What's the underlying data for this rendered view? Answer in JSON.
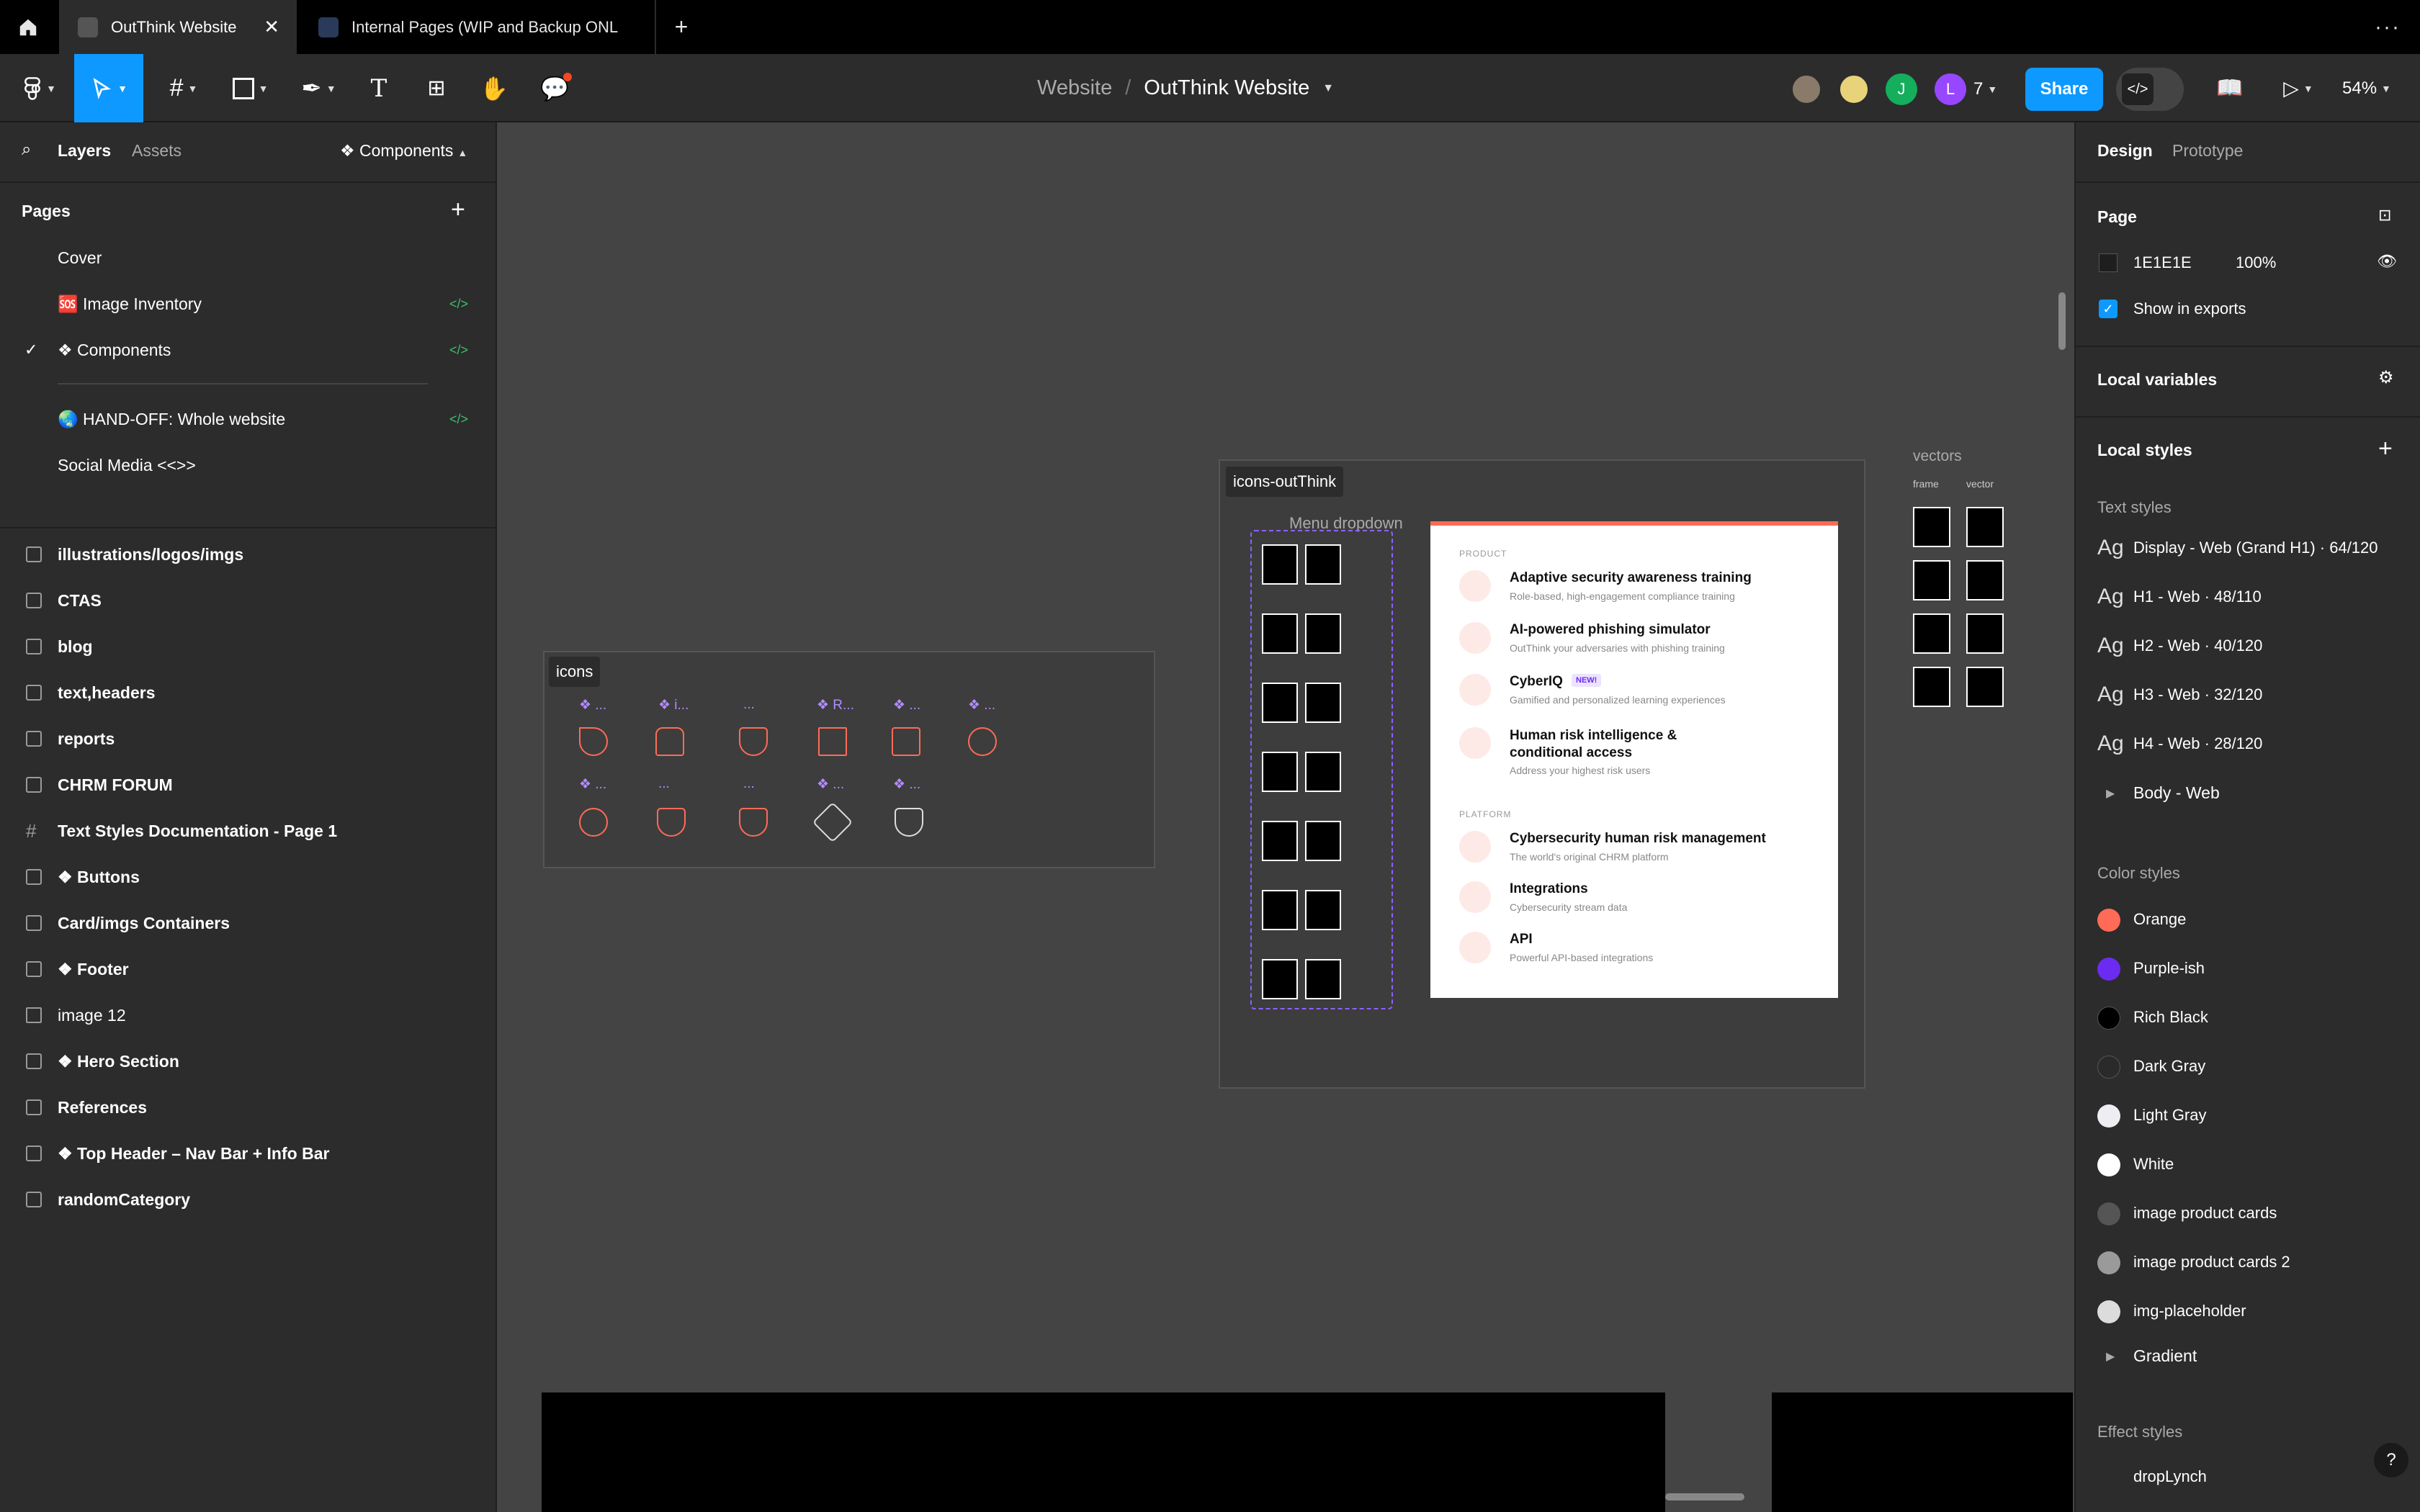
{
  "tabs": {
    "home_label": "",
    "tab1": "OutThink Website",
    "tab2": "Internal Pages (WIP and Backup ONL"
  },
  "toolbar": {
    "breadcrumb_project": "Website",
    "breadcrumb_sep": "/",
    "file_name": "OutThink Website",
    "collab_count": "7",
    "collab_j": "J",
    "collab_l": "L",
    "share": "Share",
    "zoom": "54%"
  },
  "left": {
    "tab_layers": "Layers",
    "tab_assets": "Assets",
    "components_switch": "❖ Components",
    "pages_title": "Pages",
    "pages": [
      "Cover",
      "🆘 Image Inventory",
      "❖ Components",
      "🌏 HAND-OFF: Whole website",
      "Social Media <<>>"
    ],
    "layers": [
      "illustrations/logos/imgs",
      "CTAS",
      "blog",
      "text,headers",
      "reports",
      "CHRM FORUM",
      "Text Styles Documentation - Page 1",
      "❖ Buttons",
      "Card/imgs Containers",
      "❖ Footer",
      "image 12",
      "❖ Hero Section",
      "References",
      "❖ Top Header – Nav Bar + Info Bar",
      "randomCategory"
    ]
  },
  "right": {
    "tab_design": "Design",
    "tab_prototype": "Prototype",
    "page_title": "Page",
    "page_color": "1E1E1E",
    "page_opacity": "100%",
    "show_exports": "Show in exports",
    "local_vars": "Local variables",
    "local_styles": "Local styles",
    "text_styles": "Text styles",
    "text_style_items": [
      "Display - Web (Grand H1) · 64/120",
      "H1 - Web · 48/110",
      "H2 - Web · 40/120",
      "H3 - Web · 32/120",
      "H4 - Web · 28/120"
    ],
    "body_web": "Body - Web",
    "color_styles": "Color styles",
    "colors": [
      {
        "name": "Orange",
        "hex": "#ff6b57"
      },
      {
        "name": "Purple-ish",
        "hex": "#6c2bf0"
      },
      {
        "name": "Rich Black",
        "hex": "#000000"
      },
      {
        "name": "Dark Gray",
        "hex": "#2a2a2a"
      },
      {
        "name": "Light Gray",
        "hex": "#eeeef2"
      },
      {
        "name": "White",
        "hex": "#ffffff"
      },
      {
        "name": "image product cards",
        "hex": "#555555"
      },
      {
        "name": "image product cards 2",
        "hex": "#9a9a9a"
      },
      {
        "name": "img-placeholder",
        "hex": "#dcdcdc"
      }
    ],
    "gradient": "Gradient",
    "effect_styles": "Effect styles",
    "effect_item": "dropLynch",
    "help": "?"
  },
  "canvas": {
    "icons_label": "icons",
    "icons_outthink_label": "icons-outThink",
    "menu_dropdown_label": "Menu dropdown",
    "vectors_label": "vectors",
    "vectors_frame": "frame",
    "vectors_vector": "vector",
    "icon_labels_row1": [
      "❖ ...",
      "❖ i...",
      "...",
      "❖ R...",
      "❖ ...",
      "❖ ..."
    ],
    "icon_labels_row2": [
      "❖ ...",
      "...",
      "...",
      "❖ ...",
      "❖ ..."
    ],
    "menu": {
      "product_heading": "PRODUCT",
      "platform_heading": "PLATFORM",
      "new_badge": "NEW!",
      "items": [
        {
          "title": "Adaptive security awareness training",
          "desc": "Role-based, high-engagement compliance training"
        },
        {
          "title": "AI-powered phishing simulator",
          "desc": "OutThink your adversaries with phishing training"
        },
        {
          "title": "CyberIQ",
          "desc": "Gamified and personalized learning experiences"
        },
        {
          "title": "Human risk intelligence & conditional access",
          "desc": "Address your highest risk users"
        },
        {
          "title": "Cybersecurity human risk management",
          "desc": "The world's original CHRM platform"
        },
        {
          "title": "Integrations",
          "desc": "Cybersecurity stream data"
        },
        {
          "title": "API",
          "desc": "Powerful API-based integrations"
        }
      ]
    }
  }
}
